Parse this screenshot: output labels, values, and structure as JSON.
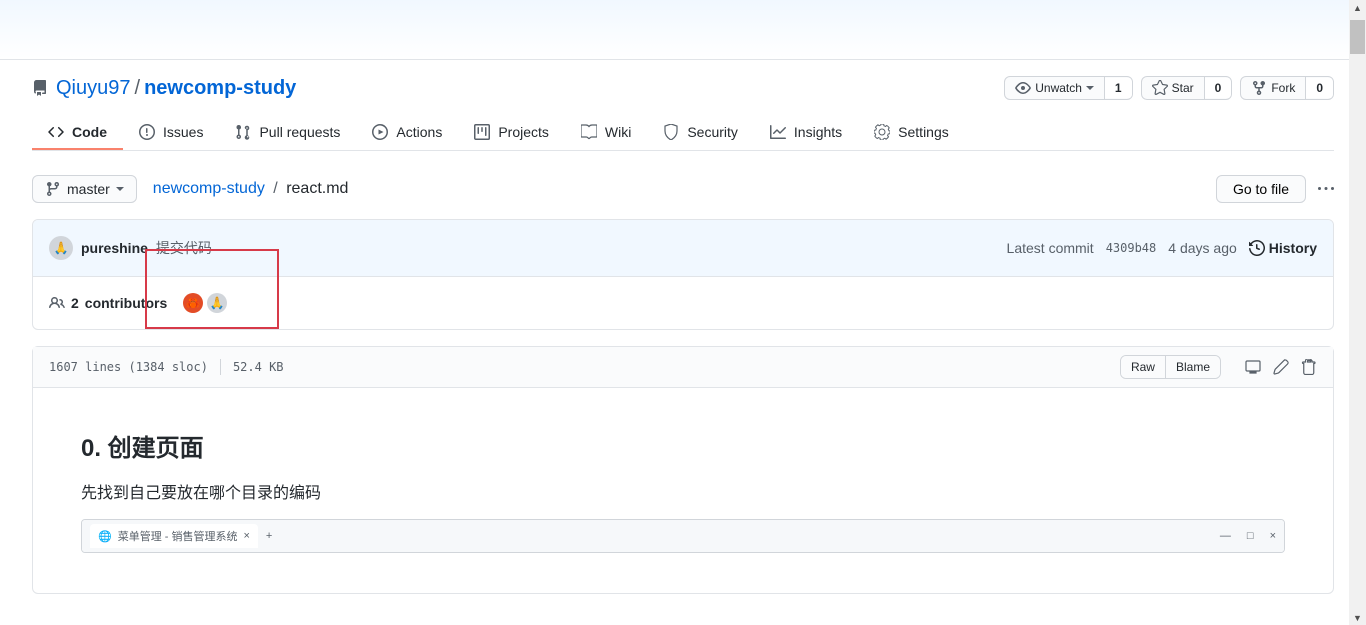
{
  "repo": {
    "owner": "Qiuyu97",
    "name": "newcomp-study"
  },
  "actions": {
    "watch": {
      "label": "Unwatch",
      "count": "1"
    },
    "star": {
      "label": "Star",
      "count": "0"
    },
    "fork": {
      "label": "Fork",
      "count": "0"
    }
  },
  "nav": {
    "code": "Code",
    "issues": "Issues",
    "pulls": "Pull requests",
    "actions": "Actions",
    "projects": "Projects",
    "wiki": "Wiki",
    "security": "Security",
    "insights": "Insights",
    "settings": "Settings"
  },
  "branch": "master",
  "breadcrumb": {
    "root": "newcomp-study",
    "file": "react.md"
  },
  "goto": "Go to file",
  "commit": {
    "author": "pureshine",
    "message": "提交代码",
    "latest": "Latest commit",
    "sha": "4309b48",
    "time": "4 days ago",
    "history": "History"
  },
  "contributors": {
    "count": "2",
    "label": "contributors"
  },
  "file_info": {
    "lines": "1607 lines (1384 sloc)",
    "size": "52.4 KB",
    "raw": "Raw",
    "blame": "Blame"
  },
  "readme": {
    "heading": "0. 创建页面",
    "paragraph": "先找到自己要放在哪个目录的编码",
    "browser_tab": "菜单管理 - 销售管理系统"
  }
}
